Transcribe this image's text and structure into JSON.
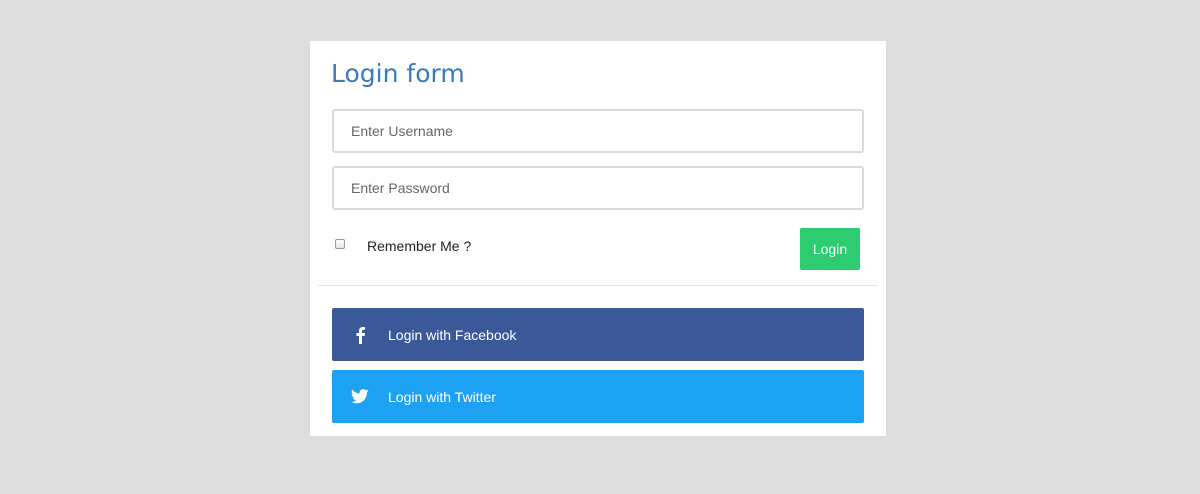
{
  "form": {
    "title": "Login form",
    "username_placeholder": "Enter Username",
    "password_placeholder": "Enter Password",
    "remember_label": "Remember Me ?",
    "remember_checked": false,
    "login_label": "Login"
  },
  "social": {
    "facebook": {
      "label": "Login with Facebook",
      "icon": "facebook-icon"
    },
    "twitter": {
      "label": "Login with Twitter",
      "icon": "twitter-icon"
    }
  },
  "colors": {
    "page_background": "#dddddd",
    "title": "#3a7bbf",
    "login_button": "#2ecc71",
    "facebook": "#3b5998",
    "twitter": "#1da1f2"
  }
}
